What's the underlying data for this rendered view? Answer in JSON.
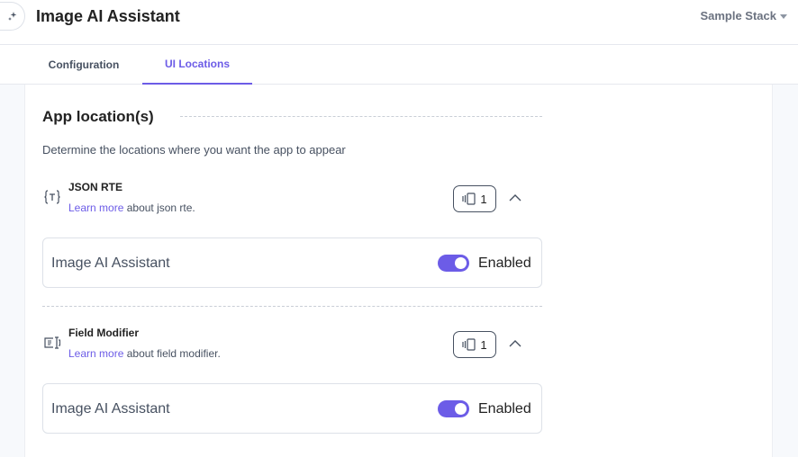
{
  "header": {
    "app_icon": "sparkle-icon",
    "title": "Image AI Assistant",
    "stack_selector": "Sample Stack"
  },
  "tabs": [
    {
      "label": "Configuration",
      "active": false
    },
    {
      "label": "UI Locations",
      "active": true
    }
  ],
  "section": {
    "title": "App location(s)",
    "description": "Determine the locations where you want the app to appear"
  },
  "locations": [
    {
      "icon": "json-rte-icon",
      "name": "JSON RTE",
      "learn_more": "Learn more",
      "about": "about json rte.",
      "count": "1",
      "item": {
        "name": "Image AI Assistant",
        "enabled": true,
        "status": "Enabled"
      }
    },
    {
      "icon": "field-modifier-icon",
      "name": "Field Modifier",
      "learn_more": "Learn more",
      "about": "about field modifier.",
      "count": "1",
      "item": {
        "name": "Image AI Assistant",
        "enabled": true,
        "status": "Enabled"
      }
    }
  ],
  "colors": {
    "accent": "#6c5ce7",
    "text": "#222222",
    "muted": "#475161"
  }
}
